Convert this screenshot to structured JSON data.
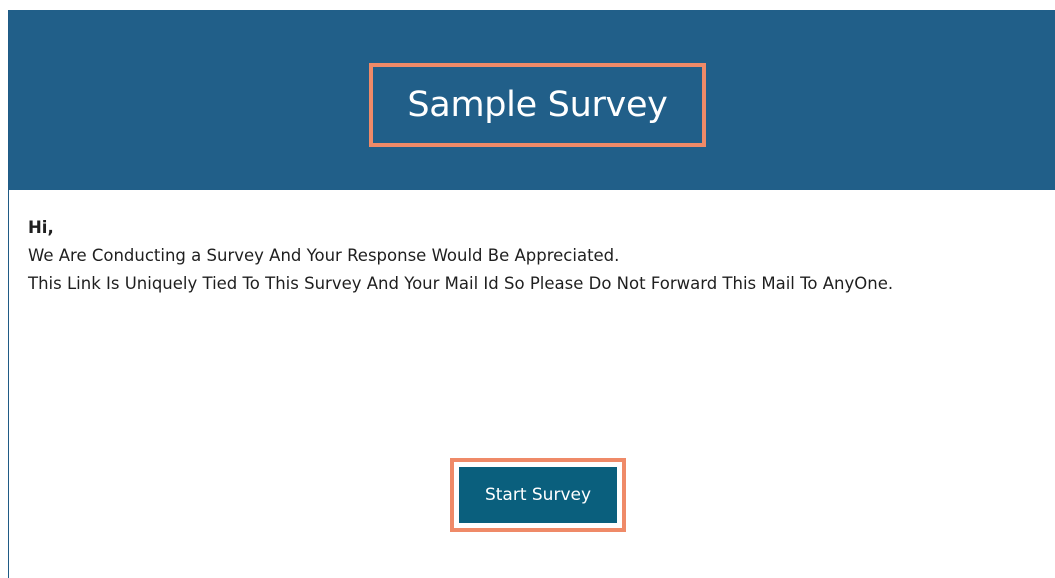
{
  "header": {
    "title": "Sample Survey"
  },
  "message": {
    "greeting": "Hi,",
    "line1": "We Are Conducting a Survey And Your Response Would Be Appreciated.",
    "line2": "This Link Is Uniquely Tied To This Survey And Your Mail Id So Please Do Not Forward This Mail To AnyOne."
  },
  "actions": {
    "start_label": "Start Survey"
  },
  "colors": {
    "header_bg": "#215f89",
    "button_bg": "#0a5f7d",
    "highlight": "#ef8a68"
  }
}
